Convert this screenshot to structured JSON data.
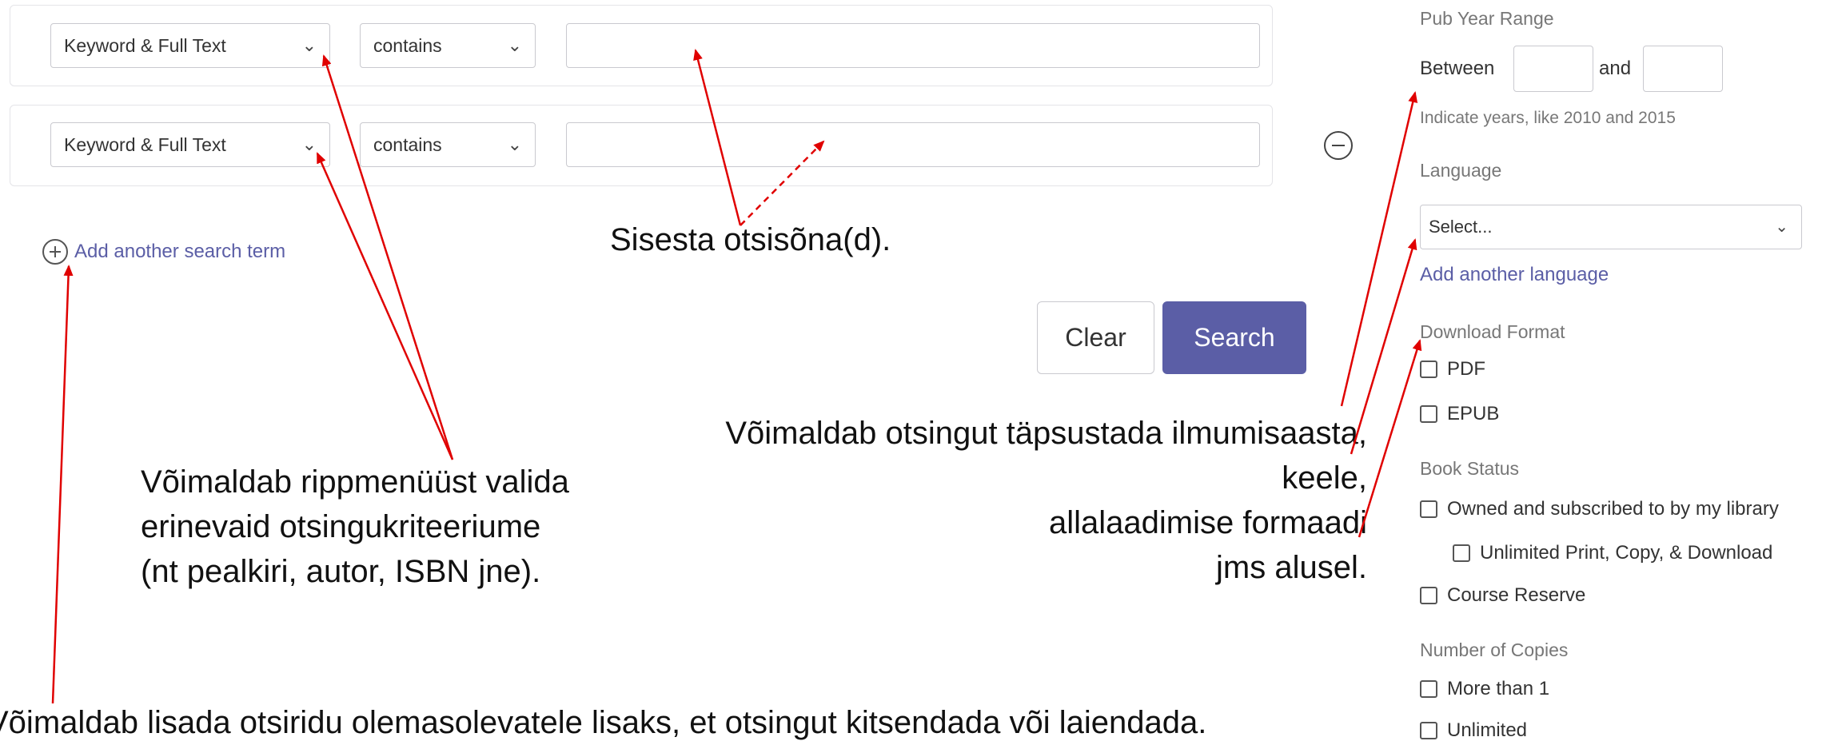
{
  "search_rows": [
    {
      "field": "Keyword & Full Text",
      "operator": "contains",
      "value": ""
    },
    {
      "field": "Keyword & Full Text",
      "operator": "contains",
      "value": ""
    }
  ],
  "add_term_label": "Add another search term",
  "buttons": {
    "clear": "Clear",
    "search": "Search"
  },
  "annotations": {
    "search_input": "Sisesta otsisõna(d).",
    "dropdown": [
      "Võimaldab rippmenüüst valida",
      "erinevaid otsingukriteeriume",
      "(nt pealkiri, autor, ISBN jne)."
    ],
    "filters": [
      "Võimaldab otsingut täpsustada ilmumisaasta,",
      "keele,",
      "allalaadimise formaadi",
      "jms alusel."
    ],
    "add_row": "Võimaldab lisada otsiridu olemasolevatele lisaks, et otsingut kitsendada või laiendada."
  },
  "sidebar": {
    "pub_year": {
      "label": "Pub Year Range",
      "between": "Between",
      "and": "and",
      "from": "",
      "to": "",
      "hint": "Indicate years, like 2010 and 2015"
    },
    "language": {
      "label": "Language",
      "select": "Select...",
      "add": "Add another language"
    },
    "download_format": {
      "label": "Download Format",
      "options": [
        "PDF",
        "EPUB"
      ]
    },
    "book_status": {
      "label": "Book Status",
      "options": [
        "Owned and subscribed to by my library",
        "Unlimited Print, Copy, & Download",
        "Course Reserve"
      ]
    },
    "copies": {
      "label": "Number of Copies",
      "options": [
        "More than 1",
        "Unlimited"
      ]
    }
  },
  "colors": {
    "accent": "#5b5ea6",
    "arrow": "#e00000"
  }
}
